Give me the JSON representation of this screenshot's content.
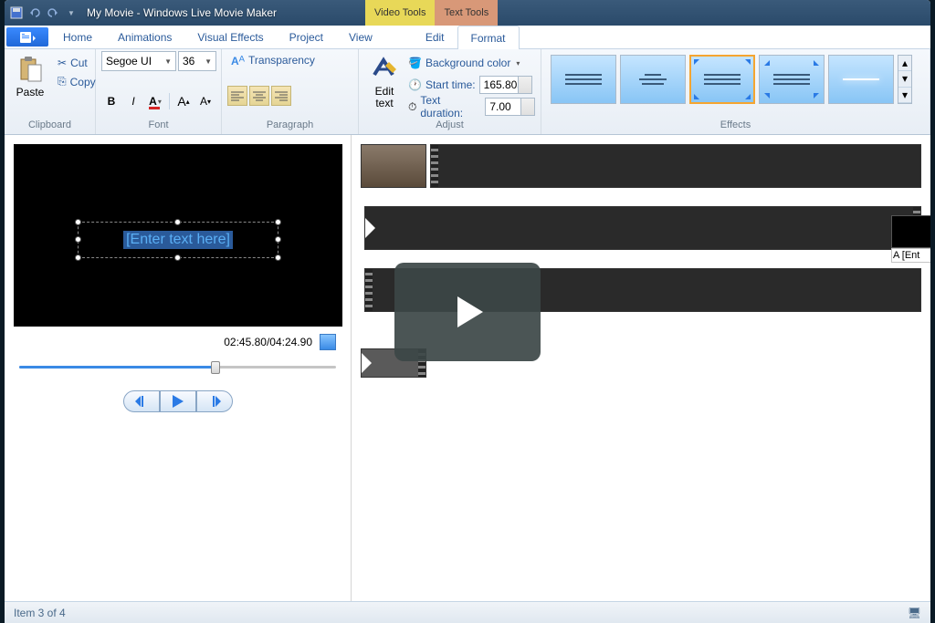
{
  "title": "My Movie - Windows Live Movie Maker",
  "tooltabs": {
    "video": "Video Tools",
    "text": "Text Tools"
  },
  "tabs": {
    "home": "Home",
    "animations": "Animations",
    "visual": "Visual Effects",
    "project": "Project",
    "view": "View",
    "edit": "Edit",
    "format": "Format"
  },
  "clipboard": {
    "label": "Clipboard",
    "paste": "Paste",
    "cut": "Cut",
    "copy": "Copy"
  },
  "font": {
    "label": "Font",
    "family": "Segoe UI",
    "size": "36",
    "transparency": "Transparency"
  },
  "paragraph": {
    "label": "Paragraph",
    "edit": "Edit\ntext"
  },
  "adjust": {
    "label": "Adjust",
    "bgcolor": "Background color",
    "start": "Start time:",
    "start_val": "165.80s",
    "duration": "Text duration:",
    "duration_val": "7.00"
  },
  "effects": {
    "label": "Effects"
  },
  "preview": {
    "placeholder": "[Enter text here]",
    "time": "02:45.80/04:24.90"
  },
  "textclip": {
    "label": "A [Ent"
  },
  "status": {
    "item": "Item 3 of 4"
  }
}
